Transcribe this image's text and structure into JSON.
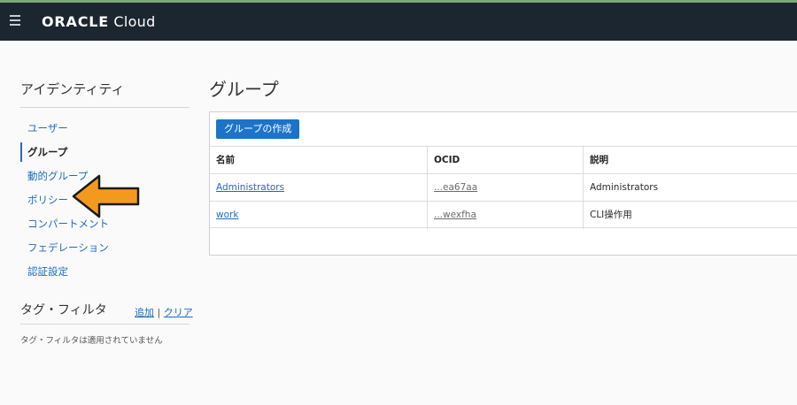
{
  "header": {
    "logo_brand": "ORACLE",
    "logo_product": "Cloud",
    "menu_icon": "hamburger-menu-icon",
    "bar_color": "#1c2630"
  },
  "sidebar": {
    "title": "アイデンティティ",
    "items": [
      {
        "label": "ユーザー",
        "active": false
      },
      {
        "label": "グループ",
        "active": true
      },
      {
        "label": "動的グループ",
        "active": false
      },
      {
        "label": "ポリシー",
        "active": false
      },
      {
        "label": "コンパートメント",
        "active": false
      },
      {
        "label": "フェデレーション",
        "active": false
      },
      {
        "label": "認証設定",
        "active": false
      }
    ]
  },
  "tag_filter": {
    "title": "タグ・フィルタ",
    "add_label": "追加",
    "separator": "|",
    "clear_label": "クリア",
    "empty_text": "タグ・フィルタは適用されていません"
  },
  "main": {
    "title": "グループ",
    "create_button": "グループの作成",
    "columns": [
      "名前",
      "OCID",
      "説明"
    ],
    "rows": [
      {
        "name": "Administrators",
        "ocid": "...ea67aa",
        "description": "Administrators"
      },
      {
        "name": "work",
        "ocid": "...wexfha",
        "description": "CLI操作用"
      }
    ]
  },
  "annotation": {
    "icon": "orange-arrow-left-icon",
    "color": "#f39a1e"
  }
}
